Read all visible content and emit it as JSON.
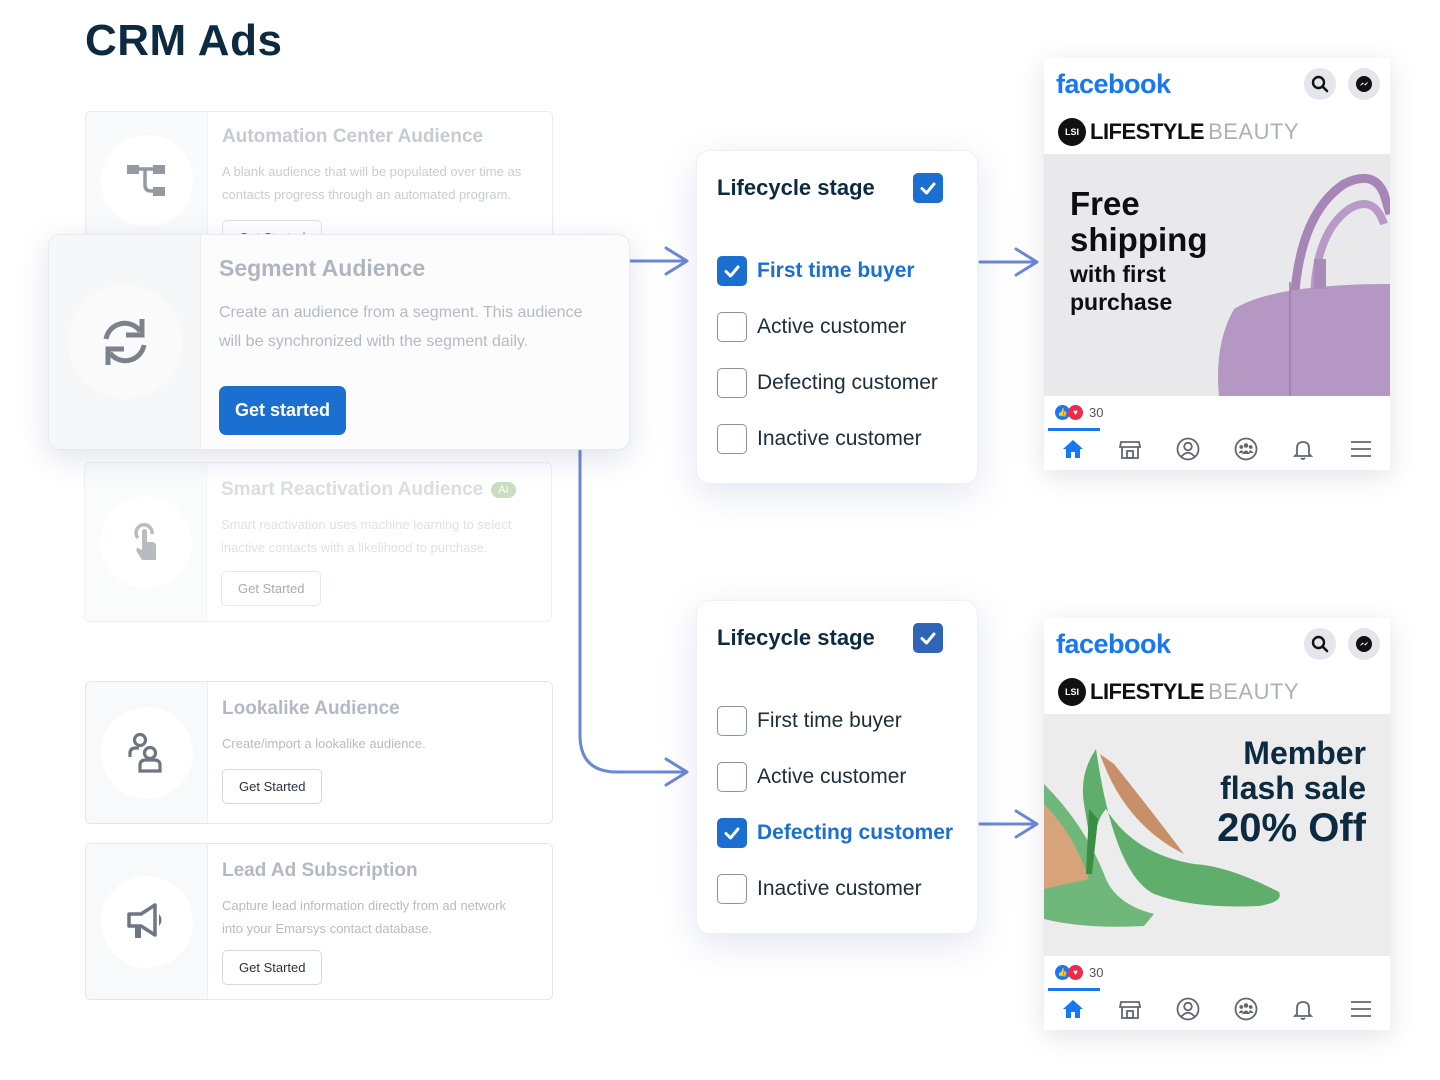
{
  "page": {
    "title": "CRM Ads"
  },
  "audience_cards": [
    {
      "id": "automation",
      "title": "Automation Center Audience",
      "description_lines": [
        "A blank audience that will be populated over time as",
        "contacts progress through an automated program."
      ],
      "button": "Get Started",
      "icon": "workflow-tree-icon"
    },
    {
      "id": "segment",
      "title": "Segment Audience",
      "description_lines": [
        "Create an audience from a segment. This audience",
        "will be synchronized with the segment daily."
      ],
      "button": "Get started",
      "icon": "sync-icon",
      "highlighted": true
    },
    {
      "id": "smart-reactivation",
      "title": "Smart Reactivation Audience",
      "badge": "AI",
      "description_lines": [
        "Smart reactivation uses machine learning to select",
        "inactive contacts with a likelihood to purchase."
      ],
      "button": "Get Started",
      "icon": "touch-icon"
    },
    {
      "id": "lookalike",
      "title": "Lookalike Audience",
      "description_lines": [
        "Create/import a lookalike audience."
      ],
      "button": "Get Started",
      "icon": "users-icon"
    },
    {
      "id": "lead-ad",
      "title": "Lead Ad Subscription",
      "description_lines": [
        "Capture lead information directly from ad network",
        "into your Emarsys contact database."
      ],
      "button": "Get Started",
      "icon": "megaphone-icon"
    }
  ],
  "lifecycle_panels": [
    {
      "title": "Lifecycle stage",
      "header_checked": true,
      "options": [
        {
          "label": "First time buyer",
          "checked": true
        },
        {
          "label": "Active customer",
          "checked": false
        },
        {
          "label": "Defecting customer",
          "checked": false
        },
        {
          "label": "Inactive customer",
          "checked": false
        }
      ]
    },
    {
      "title": "Lifecycle stage",
      "header_checked": true,
      "options": [
        {
          "label": "First time buyer",
          "checked": false
        },
        {
          "label": "Active customer",
          "checked": false
        },
        {
          "label": "Defecting customer",
          "checked": true
        },
        {
          "label": "Inactive customer",
          "checked": false
        }
      ]
    }
  ],
  "ads": [
    {
      "network": "facebook",
      "brand_primary": "LIFESTYLE",
      "brand_secondary": "BEAUTY",
      "brand_mark": "LSI",
      "headline_lines": [
        "Free",
        "shipping"
      ],
      "subline_lines": [
        "with first",
        "purchase"
      ],
      "product": "purple handbag",
      "reaction_count": "30"
    },
    {
      "network": "facebook",
      "brand_primary": "LIFESTYLE",
      "brand_secondary": "BEAUTY",
      "brand_mark": "LSI",
      "headline_lines": [
        "Member",
        "flash sale"
      ],
      "offer": "20% Off",
      "product": "green high heels",
      "reaction_count": "30"
    }
  ],
  "fb_nav": [
    "home-icon",
    "marketplace-icon",
    "profile-icon",
    "groups-icon",
    "notifications-icon",
    "menu-icon"
  ],
  "colors": {
    "primary": "#1b6fd0",
    "facebook": "#1877f2",
    "arrow": "#6a88d6",
    "title": "#0c2a40"
  }
}
